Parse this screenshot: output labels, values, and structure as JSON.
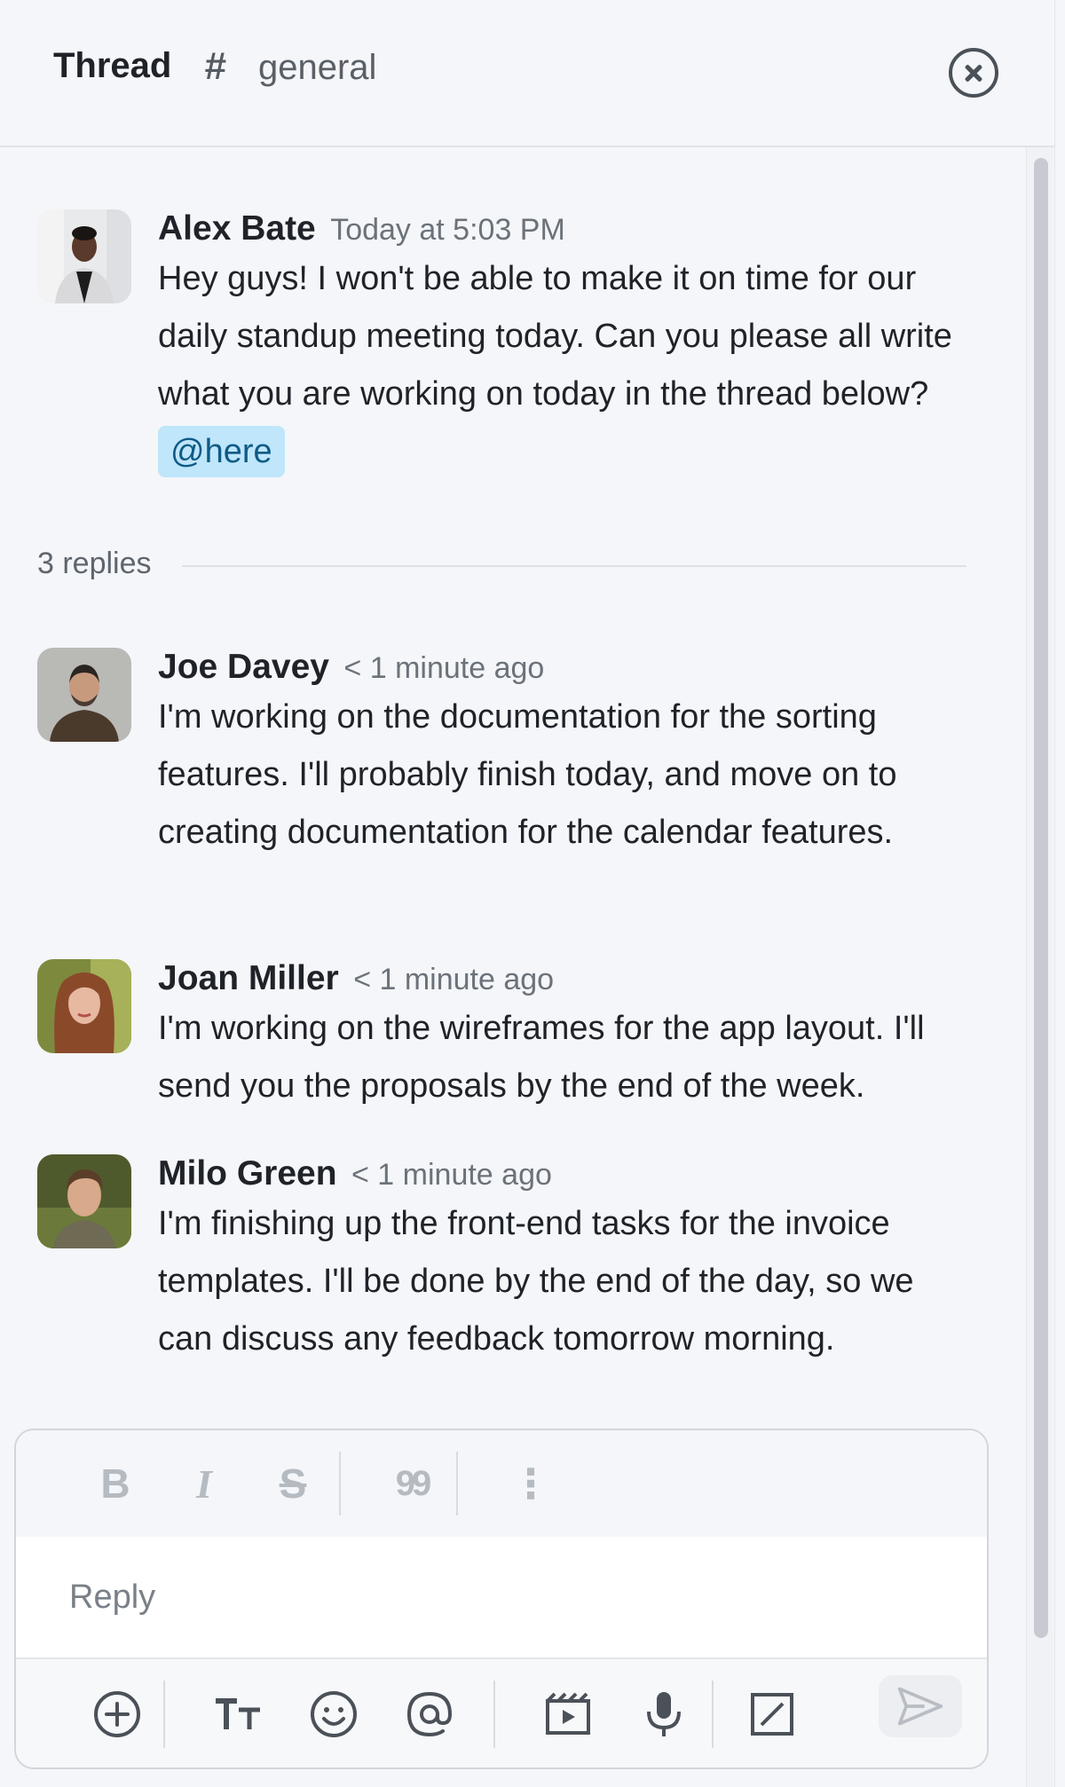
{
  "header": {
    "title": "Thread",
    "hash": "#",
    "channel": "general",
    "close_icon": "close-circle-icon"
  },
  "parent_message": {
    "author": "Alex Bate",
    "time": "Today at 5:03 PM",
    "text": "Hey guys! I won't be able to make it on time for our daily standup meeting today. Can you please all write what you are working on today in the thread below?",
    "mention": "@here"
  },
  "replies_label": "3 replies",
  "replies": [
    {
      "author": "Joe Davey",
      "time": "< 1 minute ago",
      "text": "I'm working on the documentation for the sorting features. I'll probably finish today, and move on to creating documentation for the calendar features."
    },
    {
      "author": "Joan Miller",
      "time": "< 1 minute ago",
      "text": "I'm working on the wireframes for the app layout. I'll send you the proposals by the end of the week."
    },
    {
      "author": "Milo Green",
      "time": "< 1 minute ago",
      "text": "I'm finishing up the front-end tasks for the invoice templates. I'll be done by the end of the day, so we can discuss any feedback tomorrow morning."
    }
  ],
  "composer": {
    "placeholder": "Reply",
    "format_buttons": {
      "bold": "B",
      "italic": "I",
      "strike": "S",
      "quote": "99",
      "more": "⋮"
    },
    "action_icons": [
      "plus-circle-icon",
      "text-size-icon",
      "emoji-icon",
      "at-sign-icon",
      "video-clip-icon",
      "microphone-icon",
      "slash-command-icon",
      "send-icon"
    ]
  },
  "colors": {
    "background": "#f4f6f9",
    "mention_bg": "#bfe6fb",
    "mention_text": "#0f5b86",
    "muted_text": "#6c727a"
  }
}
